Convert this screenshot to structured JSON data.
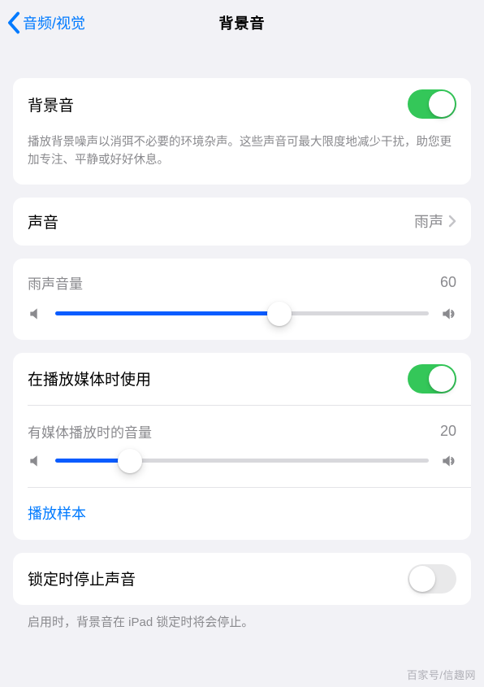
{
  "header": {
    "back_label": "音频/视觉",
    "title": "背景音"
  },
  "section_main": {
    "toggle_label": "背景音",
    "toggle_on": true,
    "description": "播放背景噪声以消弭不必要的环境杂声。这些声音可最大限度地减少干扰，助您更加专注、平静或好好休息。"
  },
  "section_sound": {
    "label": "声音",
    "value": "雨声"
  },
  "section_rain": {
    "label": "雨声音量",
    "value": "60",
    "slider_percent": 60
  },
  "section_media": {
    "toggle_label": "在播放媒体时使用",
    "toggle_on": true,
    "sub_label": "有媒体播放时的音量",
    "sub_value": "20",
    "slider_percent": 20,
    "sample_label": "播放样本"
  },
  "section_lock": {
    "toggle_label": "锁定时停止声音",
    "toggle_on": false,
    "description": "启用时，背景音在 iPad 锁定时将会停止。"
  },
  "watermark": "百家号/信趣网"
}
